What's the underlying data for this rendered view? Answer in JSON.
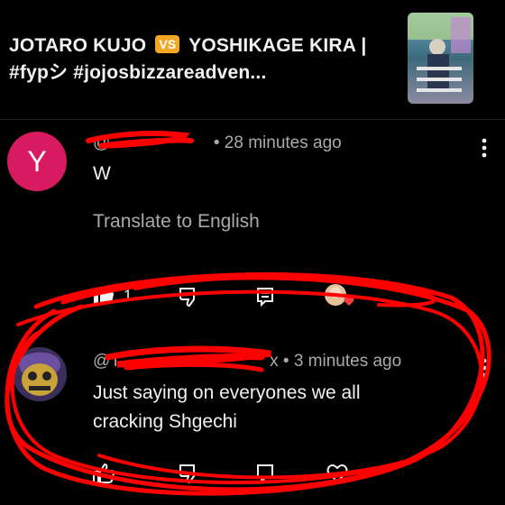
{
  "header": {
    "title_part1": "JOTARO KUJO",
    "badge": "VS",
    "title_part2": "YOSHIKAGE KIRA | #fypシ #jojosbizzareadven..."
  },
  "comments": [
    {
      "avatar_letter": "Y",
      "handle_visible": "@",
      "time": "• 28 minutes ago",
      "text": "W",
      "translate_label": "Translate to English",
      "like_count": "1"
    },
    {
      "handle_visible": "@T",
      "handle_tail": "x",
      "time": "• 3 minutes ago",
      "text": "Just saying on everyones we all cracking Shgechi"
    }
  ],
  "colors": {
    "background": "#000000",
    "avatar_y": "#d81b60",
    "vs_badge": "#f5a623",
    "scribble": "#ff0000"
  },
  "icons": [
    "thumbs-up-icon",
    "thumbs-down-icon",
    "reply-icon",
    "more-vertical-icon",
    "heart-icon"
  ]
}
